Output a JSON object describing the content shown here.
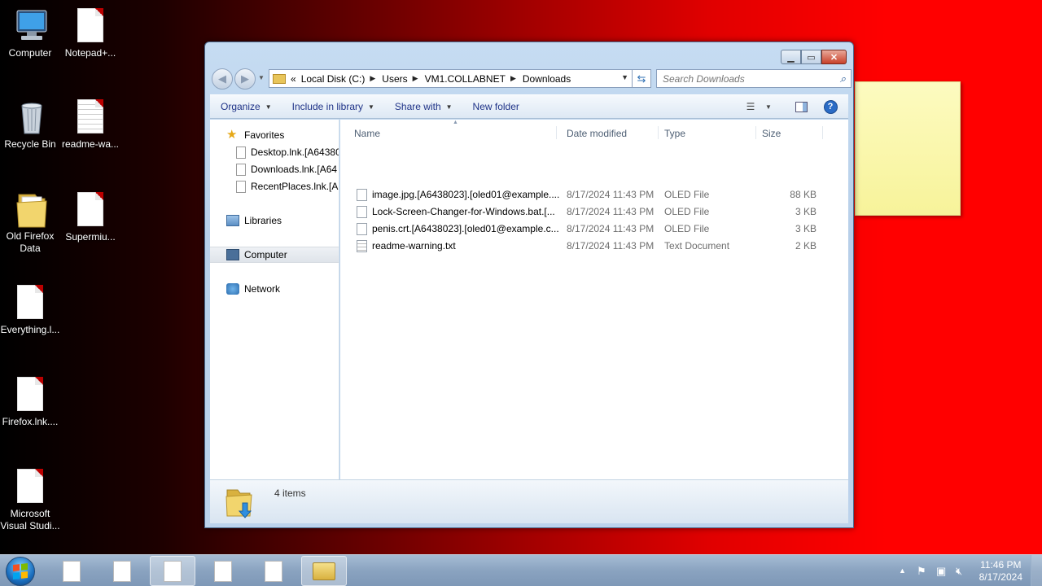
{
  "desktop": {
    "icons": [
      {
        "label": "Computer",
        "icon": "computer-icon"
      },
      {
        "label": "Notepad+...",
        "icon": "file-icon"
      },
      {
        "label": "Recycle Bin",
        "icon": "recycle-bin-icon"
      },
      {
        "label": "readme-wa...",
        "icon": "text-file-icon"
      },
      {
        "label": "Old Firefox Data",
        "icon": "folder-icon"
      },
      {
        "label": "Supermiu...",
        "icon": "file-icon"
      },
      {
        "label": "Everything.l...",
        "icon": "file-icon"
      },
      {
        "label": "Firefox.lnk....",
        "icon": "file-icon"
      },
      {
        "label": "Microsoft Visual Studi...",
        "icon": "file-icon"
      }
    ]
  },
  "explorer": {
    "address": {
      "overflow": "«",
      "crumbs": [
        "Local Disk (C:)",
        "Users",
        "VM1.COLLABNET",
        "Downloads"
      ]
    },
    "search": {
      "placeholder": "Search Downloads"
    },
    "toolbar": {
      "organize": "Organize",
      "include_in_library": "Include in library",
      "share_with": "Share with",
      "new_folder": "New folder"
    },
    "nav": {
      "favorites": "Favorites",
      "favorite_items": [
        "Desktop.lnk.[A64380",
        "Downloads.lnk.[A64",
        "RecentPlaces.lnk.[A6"
      ],
      "libraries": "Libraries",
      "computer": "Computer",
      "network": "Network"
    },
    "columns": {
      "name": "Name",
      "date_modified": "Date modified",
      "type": "Type",
      "size": "Size"
    },
    "files": [
      {
        "name": "image.jpg.[A6438023].[oled01@example....",
        "date": "8/17/2024 11:43 PM",
        "type": "OLED File",
        "size": "88 KB"
      },
      {
        "name": "Lock-Screen-Changer-for-Windows.bat.[...",
        "date": "8/17/2024 11:43 PM",
        "type": "OLED File",
        "size": "3 KB"
      },
      {
        "name": "penis.crt.[A6438023].[oled01@example.c...",
        "date": "8/17/2024 11:43 PM",
        "type": "OLED File",
        "size": "3 KB"
      },
      {
        "name": "readme-warning.txt",
        "date": "8/17/2024 11:43 PM",
        "type": "Text Document",
        "size": "2 KB"
      }
    ],
    "status": {
      "item_count": "4 items"
    }
  },
  "taskbar": {
    "clock_time": "11:46 PM",
    "clock_date": "8/17/2024"
  }
}
